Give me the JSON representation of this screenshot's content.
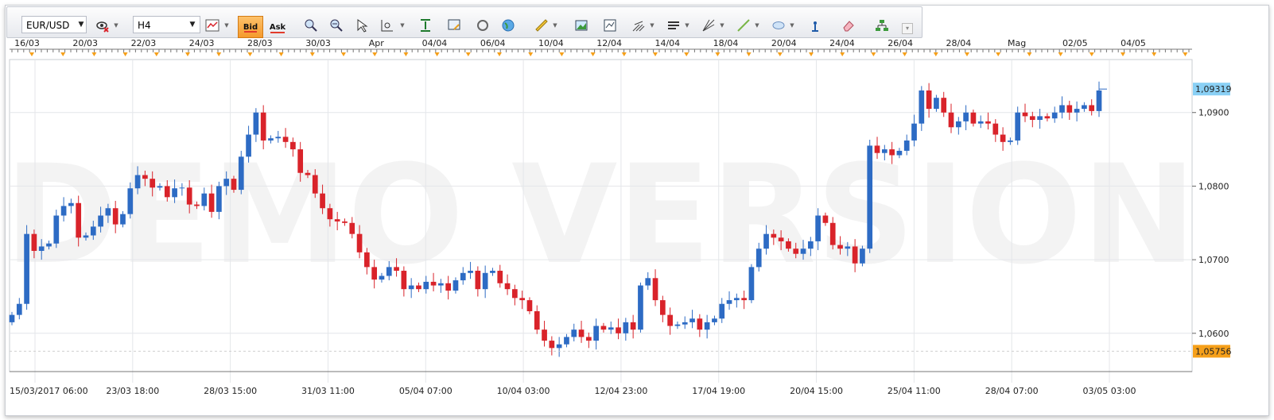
{
  "toolbar": {
    "symbol": "EUR/USD",
    "timeframe": "H4",
    "bid_label": "Bid",
    "ask_label": "Ask",
    "icons": [
      "chart-type-icon",
      "crosshair-icon",
      "zoom-icon",
      "cursor-icon",
      "zoom-range-icon",
      "fit-icon",
      "template-icon",
      "refresh-icon",
      "globe-icon",
      "ruler-icon",
      "image-icon",
      "indicator-icon",
      "fork-icon",
      "lines-icon",
      "fan-icon",
      "trendline-icon",
      "ellipse-icon",
      "text-abc-icon",
      "eraser-icon",
      "objects-icon"
    ]
  },
  "watermark": "DEMO VERSION",
  "colors": {
    "bull": "#2d6bc4",
    "bear": "#d9232a",
    "current_price_bg": "#8ad0f5",
    "low_price_bg": "#f6a01a",
    "marker": "#f6a01a"
  },
  "chart_data": {
    "type": "candlestick",
    "title": "",
    "instrument": "EUR/USD",
    "timeframe": "H4",
    "ylim": [
      1.0548,
      1.0972
    ],
    "y_ticks": [
      "1,0900",
      "1,0800",
      "1,0700",
      "1,0600"
    ],
    "y_tick_values": [
      1.09,
      1.08,
      1.07,
      1.06
    ],
    "current_price": {
      "label": "1,09319",
      "value": 1.09319
    },
    "low_marker": {
      "label": "1,05756",
      "value": 1.05756
    },
    "top_date_labels": [
      "16/03",
      "20/03",
      "22/03",
      "24/03",
      "28/03",
      "30/03",
      "Apr",
      "04/04",
      "06/04",
      "10/04",
      "12/04",
      "14/04",
      "18/04",
      "20/04",
      "24/04",
      "26/04",
      "28/04",
      "Mag",
      "02/05",
      "04/05"
    ],
    "bottom_date_labels": [
      "15/03/2017 06:00",
      "23/03 18:00",
      "28/03 15:00",
      "31/03 11:00",
      "05/04 07:00",
      "10/04 03:00",
      "12/04 23:00",
      "17/04 19:00",
      "20/04 15:00",
      "25/04 11:00",
      "28/04 07:00",
      "03/05 03:00"
    ],
    "closes": [
      1.0625,
      1.064,
      1.0735,
      1.0712,
      1.0718,
      1.0722,
      1.076,
      1.0773,
      1.0777,
      1.073,
      1.0733,
      1.0745,
      1.076,
      1.077,
      1.0748,
      1.0762,
      1.0797,
      1.0815,
      1.081,
      1.0798,
      1.08,
      1.0785,
      1.0797,
      1.0798,
      1.0775,
      1.0773,
      1.079,
      1.0765,
      1.08,
      1.081,
      1.0795,
      1.084,
      1.087,
      1.09,
      1.0862,
      1.0865,
      1.0867,
      1.086,
      1.085,
      1.0818,
      1.0815,
      1.079,
      1.077,
      1.0755,
      1.0752,
      1.075,
      1.0735,
      1.071,
      1.069,
      1.0673,
      1.0678,
      1.069,
      1.0685,
      1.066,
      1.0665,
      1.066,
      1.067,
      1.0665,
      1.0668,
      1.0658,
      1.0672,
      1.0682,
      1.0685,
      1.066,
      1.0682,
      1.0685,
      1.0668,
      1.066,
      1.0648,
      1.0645,
      1.063,
      1.0605,
      1.059,
      1.058,
      1.0585,
      1.0595,
      1.0605,
      1.0595,
      1.059,
      1.061,
      1.0605,
      1.0608,
      1.06,
      1.0615,
      1.0605,
      1.0665,
      1.0675,
      1.0645,
      1.0625,
      1.061,
      1.0612,
      1.0615,
      1.062,
      1.0605,
      1.0615,
      1.062,
      1.064,
      1.0645,
      1.0648,
      1.0645,
      1.069,
      1.0715,
      1.0735,
      1.073,
      1.0725,
      1.0715,
      1.0708,
      1.0715,
      1.0725,
      1.076,
      1.075,
      1.072,
      1.0715,
      1.0718,
      1.0695,
      1.0715,
      1.0855,
      1.0845,
      1.085,
      1.0842,
      1.0848,
      1.0862,
      1.0885,
      1.093,
      1.0905,
      1.092,
      1.09,
      1.088,
      1.0888,
      1.09,
      1.0885,
      1.0888,
      1.0885,
      1.087,
      1.086,
      1.0862,
      1.09,
      1.0895,
      1.089,
      1.0895,
      1.0892,
      1.09,
      1.091,
      1.09,
      1.0905,
      1.091,
      1.0902,
      1.093
    ]
  }
}
